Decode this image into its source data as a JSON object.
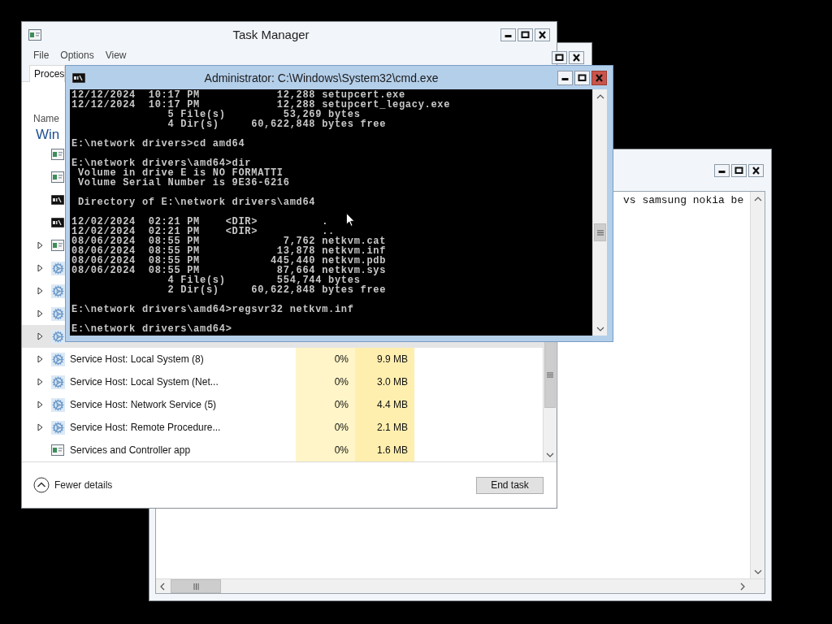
{
  "background_window": {
    "active": false
  },
  "notepad_window": {
    "active": false,
    "text": "vs samsung nokia be"
  },
  "task_manager": {
    "title": "Task Manager",
    "active": false,
    "menu": [
      "File",
      "Options",
      "View"
    ],
    "tabs": [
      {
        "label": "Proces",
        "selected": true
      }
    ],
    "columns": [
      {
        "label": "Name"
      }
    ],
    "group": "Win",
    "processes": [
      {
        "kind": "app",
        "expandable": false,
        "selected": false
      },
      {
        "kind": "app",
        "expandable": false,
        "selected": false
      },
      {
        "kind": "console",
        "expandable": false,
        "selected": false
      },
      {
        "kind": "console",
        "expandable": false,
        "selected": false
      },
      {
        "kind": "app",
        "expandable": true,
        "selected": false
      },
      {
        "kind": "service",
        "expandable": true,
        "selected": false
      },
      {
        "kind": "service",
        "expandable": true,
        "selected": false
      },
      {
        "kind": "service",
        "expandable": true,
        "selected": false
      },
      {
        "kind": "service",
        "expandable": true,
        "selected": true
      },
      {
        "kind": "service",
        "expandable": true,
        "selected": false,
        "name": "Service Host: Local System (8)",
        "cpu": "0%",
        "memory": "9.9 MB"
      },
      {
        "kind": "service",
        "expandable": true,
        "selected": false,
        "name": "Service Host: Local System (Net...",
        "cpu": "0%",
        "memory": "3.0 MB"
      },
      {
        "kind": "service",
        "expandable": true,
        "selected": false,
        "name": "Service Host: Network Service (5)",
        "cpu": "0%",
        "memory": "4.4 MB"
      },
      {
        "kind": "service",
        "expandable": true,
        "selected": false,
        "name": "Service Host: Remote Procedure...",
        "cpu": "0%",
        "memory": "2.1 MB"
      },
      {
        "kind": "app",
        "expandable": false,
        "selected": false,
        "name": "Services and Controller app",
        "cpu": "0%",
        "memory": "1.6 MB"
      }
    ],
    "footer": {
      "toggle": "Fewer details",
      "button": "End task"
    }
  },
  "cmd_window": {
    "title": "Administrator: C:\\Windows\\System32\\cmd.exe",
    "active": true,
    "blocks": [
      [
        "12/12/2024  10:17 PM            12,288 setupcert.exe",
        "12/12/2024  10:17 PM            12,288 setupcert_legacy.exe",
        "               5 File(s)         53,269 bytes",
        "               4 Dir(s)     60,622,848 bytes free"
      ],
      [
        "E:\\network drivers>cd amd64"
      ],
      [
        "E:\\network drivers\\amd64>dir",
        " Volume in drive E is NO FORMATTI",
        " Volume Serial Number is 9E36-6216"
      ],
      [
        " Directory of E:\\network drivers\\amd64"
      ],
      [
        "12/02/2024  02:21 PM    <DIR>          .",
        "12/02/2024  02:21 PM    <DIR>          ..",
        "08/06/2024  08:55 PM             7,762 netkvm.cat",
        "08/06/2024  08:55 PM            13,878 netkvm.inf",
        "08/06/2024  08:55 PM           445,440 netkvm.pdb",
        "08/06/2024  08:55 PM            87,664 netkvm.sys",
        "               4 File(s)        554,744 bytes",
        "               2 Dir(s)     60,622,848 bytes free"
      ],
      [
        "E:\\network drivers\\amd64>regsvr32 netkvm.inf"
      ],
      [
        "E:\\network drivers\\amd64>"
      ]
    ]
  }
}
